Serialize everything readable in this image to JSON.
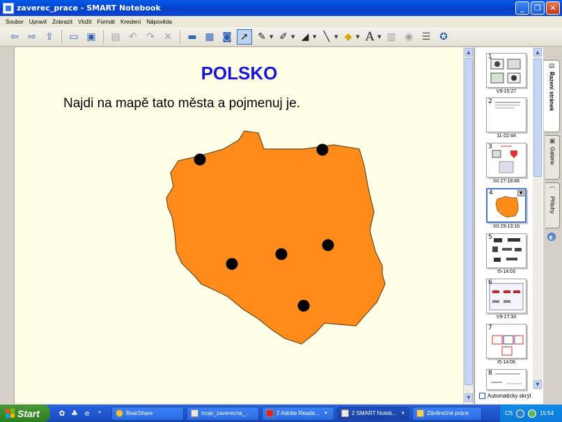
{
  "window": {
    "title": "zaverec_prace - SMART Notebook",
    "controls": [
      "minimize",
      "restore",
      "close"
    ]
  },
  "menu": {
    "items": [
      "Soubor",
      "Upravit",
      "Zobrazit",
      "Vložit",
      "Formát",
      "Kreslení",
      "Nápověda"
    ]
  },
  "toolbar": {
    "icons": [
      "back-icon",
      "forward-icon",
      "add-page-icon",
      "open-icon",
      "save-icon",
      "paste-icon",
      "undo-icon",
      "redo-icon",
      "delete-icon",
      "screen-shade-icon",
      "full-screen-icon",
      "capture-icon",
      "select-icon",
      "pen-icon",
      "creative-pen-icon",
      "eraser-icon",
      "line-icon",
      "fill-icon",
      "text-icon",
      "properties-icon",
      "record-icon",
      "toolbar-options-icon",
      "help-icon"
    ]
  },
  "page": {
    "title": "POLSKO",
    "instruction": "Najdi na mapě tato města a pojmenuj je.",
    "colors": {
      "title": "#1717d8",
      "map_fill": "#ff8c1a",
      "dot": "#000000",
      "background": "#ffffe8"
    }
  },
  "sorter": {
    "tab_label": "Řazení stránek",
    "pages": [
      {
        "num": "1",
        "label": "V9-15:27"
      },
      {
        "num": "2",
        "label": "11-22:44"
      },
      {
        "num": "3",
        "label": "XII 27-18:46"
      },
      {
        "num": "4",
        "label": "XII 29-13:16",
        "active": true
      },
      {
        "num": "5",
        "label": "I5-14:03"
      },
      {
        "num": "6",
        "label": "V9-17:33"
      },
      {
        "num": "7",
        "label": "I5-14:06"
      },
      {
        "num": "8",
        "label": ""
      }
    ],
    "autohide_label": "Automaticky skrýt"
  },
  "tabs": {
    "gallery_label": "Galerie",
    "attachments_label": "Přílohy"
  },
  "taskbar": {
    "start_label": "Start",
    "tasks": [
      {
        "label": "BearShare"
      },
      {
        "label": "moje_zaverecna_..."
      },
      {
        "label": "2 Adobe Reade..."
      },
      {
        "label": "2 SMART Noteb..."
      },
      {
        "label": "Závěrečné práce"
      }
    ],
    "language": "CS",
    "clock": "15:54"
  }
}
